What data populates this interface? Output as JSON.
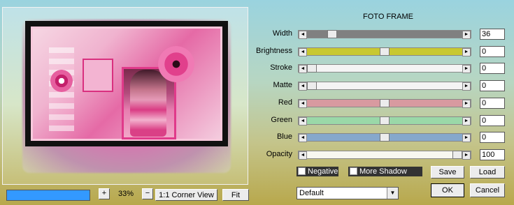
{
  "title": "FOTO FRAME",
  "preview": {
    "zoom_plus": "+",
    "zoom_minus": "−",
    "zoom_value": "33%",
    "corner_view_label": "1:1 Corner View",
    "fit_label": "Fit",
    "progress": 1.0,
    "progress_color": "#3399ff"
  },
  "sliders": [
    {
      "label": "Width",
      "value": "36",
      "position": 0.14,
      "track_color": "#808080"
    },
    {
      "label": "Brightness",
      "value": "0",
      "position": 0.5,
      "track_color": "#c8c830"
    },
    {
      "label": "Stroke",
      "value": "0",
      "position": 0.0,
      "track_color": "#f4f4f4"
    },
    {
      "label": "Matte",
      "value": "0",
      "position": 0.0,
      "track_color": "#f4f4f4"
    },
    {
      "label": "Red",
      "value": "0",
      "position": 0.5,
      "track_color": "#d89aa0"
    },
    {
      "label": "Green",
      "value": "0",
      "position": 0.5,
      "track_color": "#9ad8a8"
    },
    {
      "label": "Blue",
      "value": "0",
      "position": 0.5,
      "track_color": "#86a8cc"
    },
    {
      "label": "Opacity",
      "value": "100",
      "position": 1.0,
      "track_color": "#f8f8f0"
    }
  ],
  "checkboxes": {
    "negative": {
      "label": "Negative",
      "checked": false
    },
    "more_shadow": {
      "label": "More Shadow",
      "checked": false
    }
  },
  "preset": {
    "selected": "Default"
  },
  "buttons": {
    "save": "Save",
    "load": "Load",
    "ok": "OK",
    "cancel": "Cancel"
  },
  "icons": {
    "slider_left": "◄",
    "slider_right": "►",
    "dropdown": "▼"
  }
}
